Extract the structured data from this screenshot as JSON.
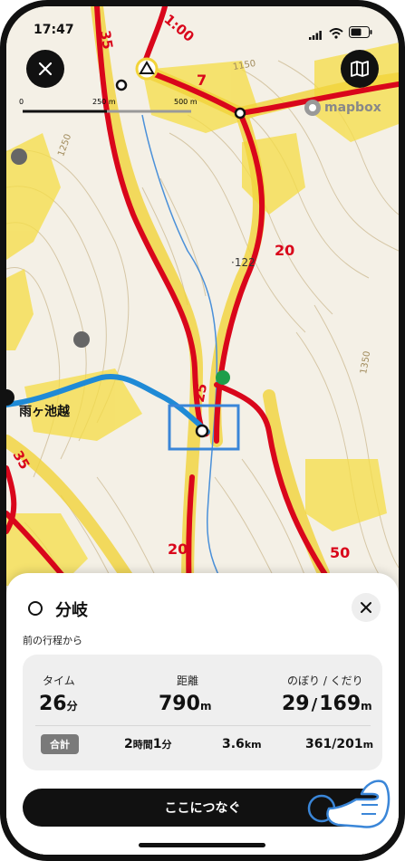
{
  "status_bar": {
    "time": "17:47"
  },
  "map": {
    "scale": {
      "zero": "0",
      "mid": "250 m",
      "end": "500 m"
    },
    "attribution": "mapbox",
    "labels": {
      "time_1": "1:00",
      "num_35_top": "35",
      "num_7": "7",
      "elev_1150": "1150",
      "elev_1250": "1250",
      "num_20_right": "20",
      "elev_122": "·122",
      "elev_1350": "1350",
      "num_25": "25",
      "num_35_left": "35",
      "num_20_bottom": "20",
      "num_50": "50",
      "place": "雨ヶ池越"
    },
    "route_color": "#d9061b",
    "track_color": "#1f8ad6",
    "highlight_color": "#3a86d8"
  },
  "sheet": {
    "title": "分岐",
    "subtitle": "前の行程から",
    "stats": {
      "time_label": "タイム",
      "time_value": "26",
      "time_unit": "分",
      "distance_label": "距離",
      "distance_value": "790",
      "distance_unit": "m",
      "updown_label": "のぼり / くだり",
      "up_value": "29",
      "sep": "/",
      "down_value": "169",
      "updown_unit": "m"
    },
    "total": {
      "badge": "合計",
      "hours": "2",
      "hours_unit": "時間",
      "minutes": "1",
      "minutes_unit": "分",
      "distance": "3.6",
      "distance_unit": "km",
      "updown": "361/201",
      "updown_unit": "m"
    },
    "cta_label": "ここにつなぐ"
  }
}
